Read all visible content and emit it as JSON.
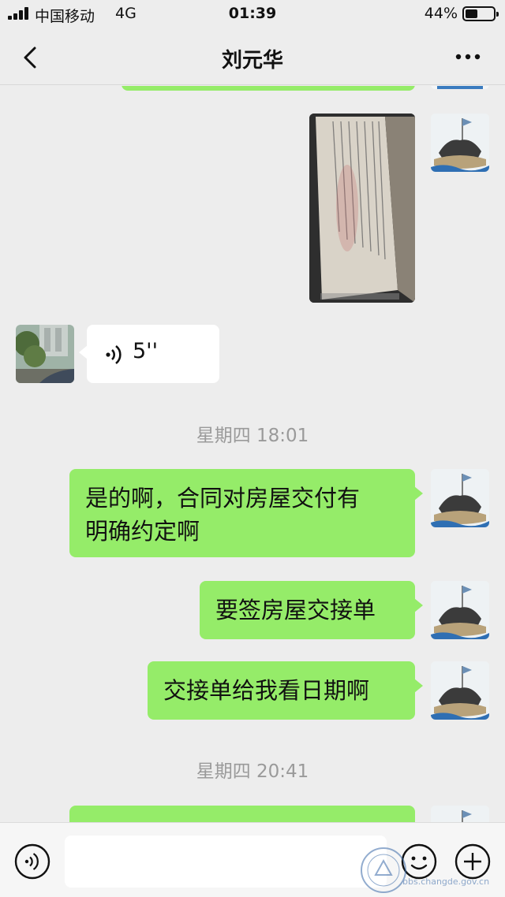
{
  "status_bar": {
    "carrier": "中国移动",
    "network": "4G",
    "time": "01:39",
    "battery_percent": "44%",
    "battery_level": 0.44
  },
  "nav": {
    "title": "刘元华",
    "back_icon": "chevron-left-icon",
    "more_icon": "ellipsis-icon"
  },
  "messages": [
    {
      "kind": "image",
      "from": "me",
      "description_icon": "document-photo"
    },
    {
      "kind": "voice",
      "from": "contact",
      "duration": "5''"
    },
    {
      "kind": "timestamp",
      "text": "星期四 18:01"
    },
    {
      "kind": "text",
      "from": "me",
      "lines": [
        "是的啊，合同对房屋交付有",
        "明确约定啊"
      ]
    },
    {
      "kind": "text",
      "from": "me",
      "text": "要签房屋交接单"
    },
    {
      "kind": "text",
      "from": "me",
      "text": "交接单给我看日期啊"
    },
    {
      "kind": "timestamp",
      "text": "星期四 20:41"
    }
  ],
  "input_bar": {
    "value": "",
    "voice_icon": "voice-icon",
    "emoji_icon": "emoji-icon",
    "plus_icon": "plus-icon"
  },
  "watermark": {
    "text": "bbs.changde.gov.cn"
  },
  "colors": {
    "background": "#ededed",
    "my_bubble": "#95ec69",
    "their_bubble": "#ffffff",
    "timestamp_text": "#9a9a9a"
  }
}
